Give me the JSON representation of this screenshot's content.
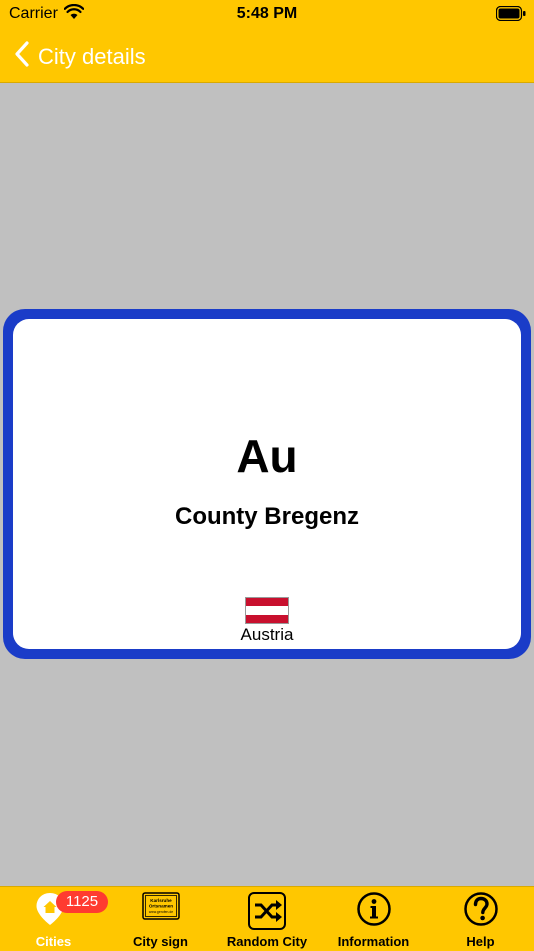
{
  "status_bar": {
    "carrier": "Carrier",
    "time": "5:48 PM"
  },
  "nav": {
    "back_title": "City details"
  },
  "sign": {
    "city": "Au",
    "county": "County Bregenz",
    "country": "Austria"
  },
  "tabs": [
    {
      "label": "Cities",
      "badge": "1125",
      "icon": "map-pin-house-icon",
      "active": true
    },
    {
      "label": "City sign",
      "icon": "city-sign-icon"
    },
    {
      "label": "Random City",
      "icon": "shuffle-icon"
    },
    {
      "label": "Information",
      "icon": "info-icon"
    },
    {
      "label": "Help",
      "icon": "help-icon"
    }
  ],
  "colors": {
    "bar_yellow": "#ffc700",
    "background_gray": "#c0c0c0",
    "sign_border_blue": "#1a3cc8",
    "badge_red": "#ff3b30",
    "flag_red": "#c8102e",
    "flag_white": "#ffffff"
  },
  "city_sign_icon_text": [
    "Karlsruhe",
    "Ortsnamen",
    "www.gerofen.de"
  ]
}
